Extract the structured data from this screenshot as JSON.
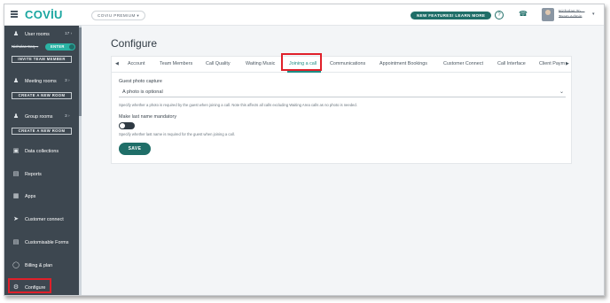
{
  "header": {
    "logo": "COVİU",
    "plan_label": "COVIU PREMIUM ▾",
    "new_features": "NEW FEATURES! LEARN MORE",
    "help": "?",
    "user_name": "Nicholas To…",
    "user_sub": "Team Admin"
  },
  "sidebar": {
    "user_rooms": {
      "label": "User rooms",
      "count": "17 ›"
    },
    "status": {
      "name": "Nicholas Seq…",
      "enter": "ENTER"
    },
    "invite": "INVITE TEAM MEMBER",
    "meeting_rooms": {
      "label": "Meeting rooms",
      "count": "3 ›"
    },
    "create_meeting": "CREATE A NEW ROOM",
    "group_rooms": {
      "label": "Group rooms",
      "count": "3 ›"
    },
    "create_group": "CREATE A NEW ROOM",
    "items": [
      {
        "label": "Data collections",
        "icon": "data-collections-icon"
      },
      {
        "label": "Reports",
        "icon": "reports-icon"
      },
      {
        "label": "Apps",
        "icon": "apps-icon"
      },
      {
        "label": "Customer connect",
        "icon": "customer-connect-icon"
      },
      {
        "label": "Customisable Forms",
        "icon": "forms-icon"
      },
      {
        "label": "Billing & plan",
        "icon": "billing-icon"
      },
      {
        "label": "Configure",
        "icon": "gear-icon"
      }
    ]
  },
  "main": {
    "title": "Configure",
    "tabs": [
      "Account",
      "Team Members",
      "Call Quality",
      "Waiting Music",
      "Joining a call",
      "Communications",
      "Appointment Bookings",
      "Customer Connect",
      "Call Interface",
      "Client Paym"
    ],
    "active_tab": "Joining a call",
    "photo_label": "Guest photo capture",
    "photo_value": "A photo is optional",
    "photo_help": "Specify whether a photo is required by the guest when joining a call. Note this affects all calls excluding Waiting Area calls as no photo is needed.",
    "lastname_label": "Make last name mandatory",
    "lastname_help": "Specify whether last name is required for the guest when joining a call.",
    "save": "SAVE"
  },
  "colors": {
    "brand": "#1aa6a0",
    "primary_button": "#1f6e68",
    "sidebar": "#3d4750",
    "highlight": "#e0202a"
  }
}
